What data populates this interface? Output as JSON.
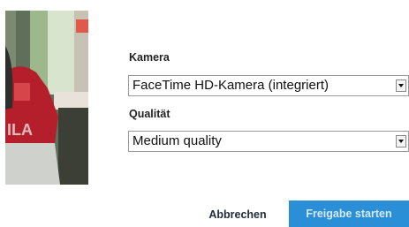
{
  "camera": {
    "label": "Kamera",
    "selected": "FaceTime HD-Kamera (integriert)"
  },
  "quality": {
    "label": "Qualität",
    "selected": "Medium quality"
  },
  "actions": {
    "cancel_label": "Abbrechen",
    "start_label": "Freigabe starten"
  },
  "preview": {
    "overlay_text": "ILA"
  },
  "colors": {
    "primary_button": "#2b8fd8",
    "primary_button_text": "#d6e9f8"
  }
}
